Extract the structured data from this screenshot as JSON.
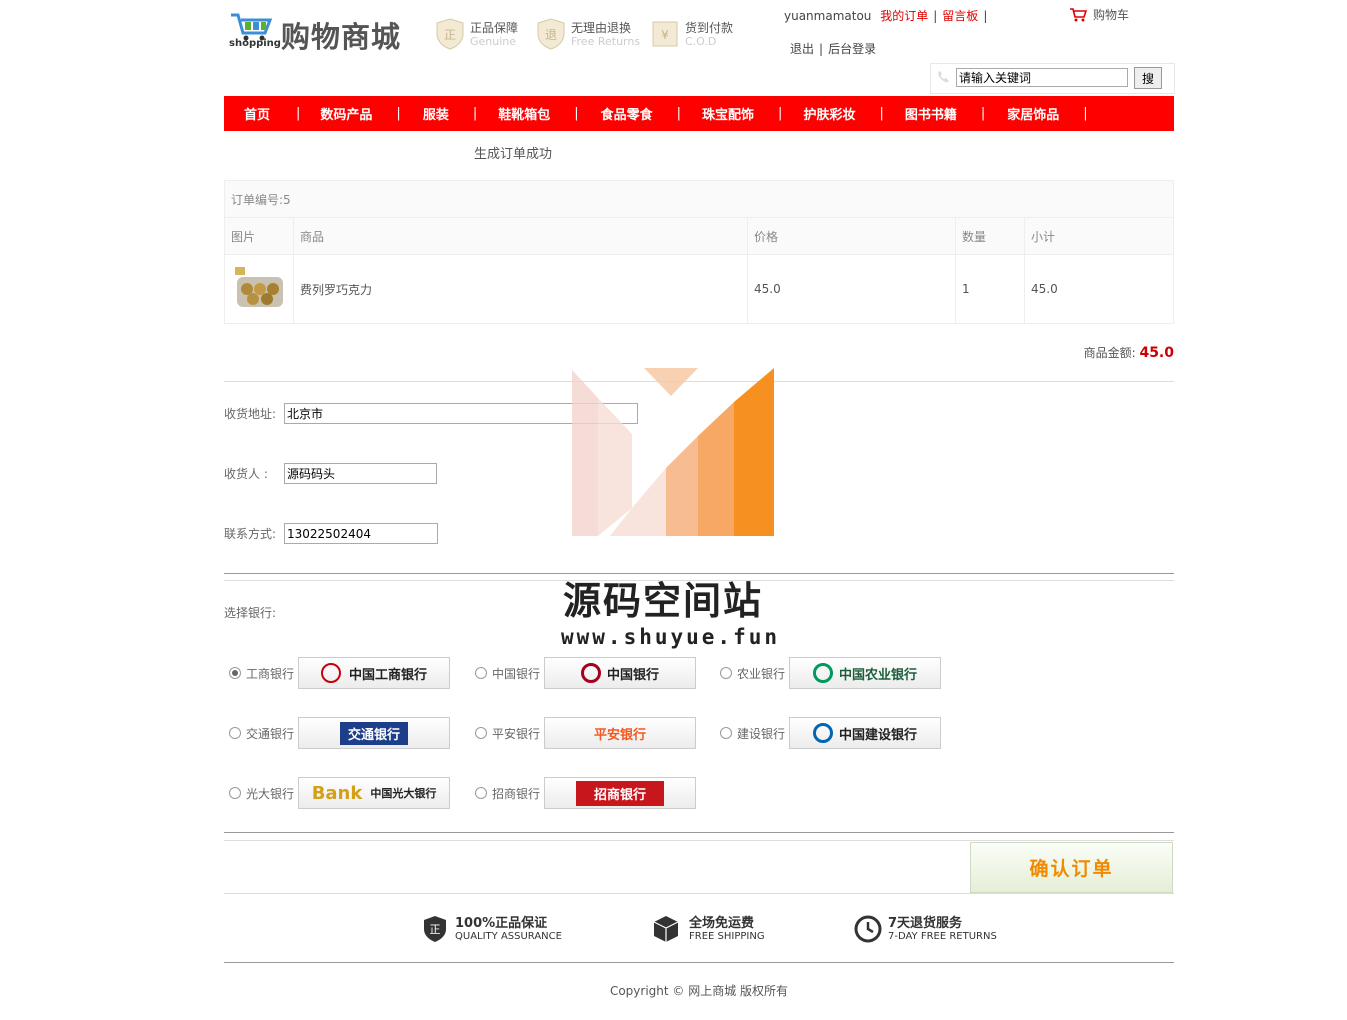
{
  "header": {
    "logo_text": "购物商城",
    "logo_sub": "shopping",
    "badges": [
      {
        "title": "正品保障",
        "sub": "Genuine",
        "glyph": "正"
      },
      {
        "title": "无理由退换",
        "sub": "Free Returns",
        "glyph": "退"
      },
      {
        "title": "货到付款",
        "sub": "C.O.D",
        "glyph": "¥"
      }
    ],
    "user": "yuanmamatou",
    "my_orders": "我的订单",
    "message_board": "留言板",
    "logout": "退出",
    "admin_login": "后台登录",
    "cart": "购物车",
    "search_placeholder": "请输入关键词",
    "search_button": "搜"
  },
  "nav": [
    "首页",
    "数码产品",
    "服装",
    "鞋靴箱包",
    "食品零食",
    "珠宝配饰",
    "护肤彩妆",
    "图书书籍",
    "家居饰品"
  ],
  "success_msg": "生成订单成功",
  "order": {
    "number_label": "订单编号:5",
    "columns": [
      "图片",
      "商品",
      "价格",
      "数量",
      "小计"
    ],
    "items": [
      {
        "name": "费列罗巧克力",
        "price": "45.0",
        "qty": "1",
        "subtotal": "45.0"
      }
    ],
    "amount_label": "商品金额:",
    "amount_value": "45.0"
  },
  "form": {
    "address_label": "收货地址:",
    "address_value": "北京市",
    "receiver_label": "收货人 :",
    "receiver_value": "源码码头",
    "phone_label": "联系方式:",
    "phone_value": "13022502404",
    "bank_label": "选择银行:"
  },
  "banks": [
    {
      "name": "工商银行",
      "logo": "中国工商银行",
      "color": "#c7000b",
      "selected": true
    },
    {
      "name": "中国银行",
      "logo": "中国银行",
      "color": "#a5001e",
      "selected": false
    },
    {
      "name": "农业银行",
      "logo": "中国农业银行",
      "color": "#009a5d",
      "selected": false
    },
    {
      "name": "交通银行",
      "logo": "交通银行",
      "color": "#1d3f8a",
      "selected": false
    },
    {
      "name": "平安银行",
      "logo": "平安银行",
      "color": "#f05a22",
      "selected": false
    },
    {
      "name": "建设银行",
      "logo": "中国建设银行",
      "color": "#0066b3",
      "selected": false
    },
    {
      "name": "光大银行",
      "logo": "中国光大银行",
      "color": "#5a2b82",
      "selected": false
    },
    {
      "name": "招商银行",
      "logo": "招商银行",
      "color": "#c8161d",
      "selected": false
    }
  ],
  "confirm_button": "确认订单",
  "features": [
    {
      "title": "100%正品保证",
      "sub": "QUALITY ASSURANCE"
    },
    {
      "title": "全场免运费",
      "sub": "FREE SHIPPING"
    },
    {
      "title": "7天退货服务",
      "sub": "7-DAY FREE RETURNS"
    }
  ],
  "copyright": "Copyright © 网上商城 版权所有",
  "watermark": {
    "title": "源码空间站",
    "url": "www.shuyue.fun"
  }
}
